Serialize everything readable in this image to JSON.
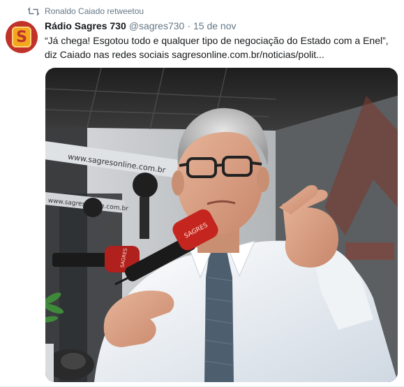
{
  "retweet": {
    "icon": "retweet-icon",
    "text": "Ronaldo Caiado retweetou"
  },
  "author": {
    "avatar_letter": "S",
    "display_name": "Rádio Sagres 730",
    "handle": "@sagres730",
    "separator": "·",
    "date": "15 de nov"
  },
  "tweet": {
    "text": "“Já chega! Esgotou todo e qualquer tipo de negociação do Estado com a Enel”, diz Caiado nas redes sociais ",
    "link": "sagresonline.com.br/noticias/polit..."
  },
  "media": {
    "mic_label": "www.sagresonline.com.br",
    "mic_label_short": "www.sagresonline.com.br",
    "windscreen_label": "SAGRES"
  },
  "colors": {
    "meta_text": "#657786",
    "primary_text": "#14171a",
    "avatar_bg": "#c0322a",
    "avatar_logo": "#f4a61e"
  }
}
